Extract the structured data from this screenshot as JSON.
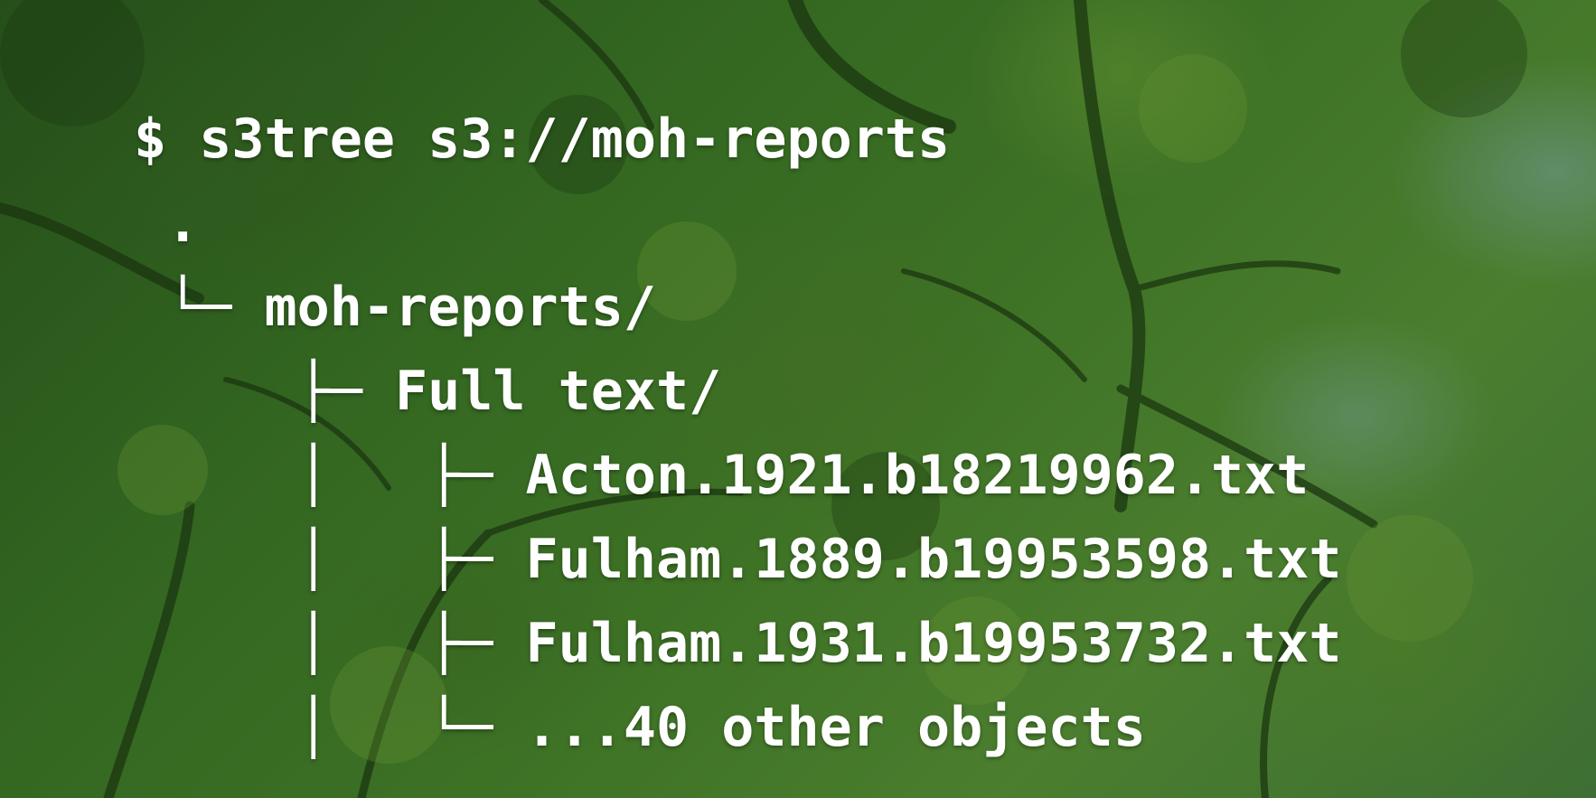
{
  "terminal": {
    "command": "$ s3tree s3://moh-reports",
    "lines": [
      " .",
      " └─ moh-reports/",
      "     ├─ Full text/",
      "     │   ├─ Acton.1921.b18219962.txt",
      "     │   ├─ Fulham.1889.b19953598.txt",
      "     │   ├─ Fulham.1931.b19953732.txt",
      "     │   └─ ...40 other objects"
    ]
  },
  "colors": {
    "text": "#ffffff",
    "foliage_dark": "#2d5a1f",
    "foliage_light": "#5f9a3a",
    "sky": "#96bec8"
  },
  "background": {
    "description_icon": "tree-canopy-photo"
  }
}
